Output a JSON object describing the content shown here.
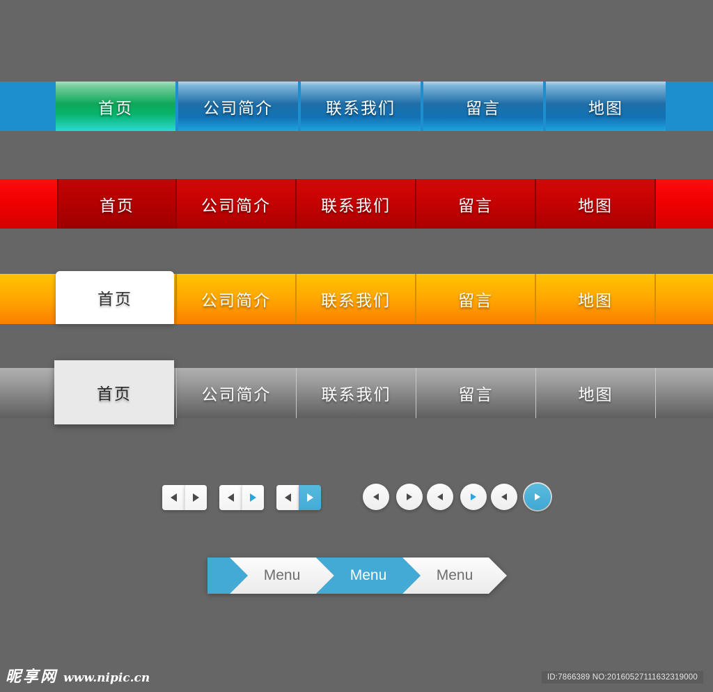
{
  "page": {
    "background": "#666666",
    "accent_blue": "#42aad4"
  },
  "navbars": [
    {
      "id": "blue",
      "style": "blue-gradient",
      "bar_color": "#1d8fce",
      "active_color": "#0fa85a",
      "items": [
        {
          "label": "首页",
          "active": true
        },
        {
          "label": "公司简介",
          "active": false
        },
        {
          "label": "联系我们",
          "active": false
        },
        {
          "label": "留言",
          "active": false
        },
        {
          "label": "地图",
          "active": false
        }
      ]
    },
    {
      "id": "red",
      "style": "red-gradient",
      "bar_color": "#f20000",
      "active_color": "#b40000",
      "items": [
        {
          "label": "首页",
          "active": true
        },
        {
          "label": "公司简介",
          "active": false
        },
        {
          "label": "联系我们",
          "active": false
        },
        {
          "label": "留言",
          "active": false
        },
        {
          "label": "地图",
          "active": false
        }
      ]
    },
    {
      "id": "orange",
      "style": "orange-gradient",
      "bar_color": "#ffa800",
      "active_color": "#ffffff",
      "items": [
        {
          "label": "首页",
          "active": true
        },
        {
          "label": "公司简介",
          "active": false
        },
        {
          "label": "联系我们",
          "active": false
        },
        {
          "label": "留言",
          "active": false
        },
        {
          "label": "地图",
          "active": false
        }
      ]
    },
    {
      "id": "gray",
      "style": "gray-gradient",
      "bar_color": "#8e8e8e",
      "active_color": "#e9e9e9",
      "items": [
        {
          "label": "首页",
          "active": true
        },
        {
          "label": "公司简介",
          "active": false
        },
        {
          "label": "联系我们",
          "active": false
        },
        {
          "label": "留言",
          "active": false
        },
        {
          "label": "地图",
          "active": false
        }
      ]
    }
  ],
  "pagers": {
    "square_groups": [
      {
        "prev_icon": "arrow-left-icon",
        "next_icon": "arrow-right-icon",
        "prev_state": "default",
        "next_state": "default"
      },
      {
        "prev_icon": "arrow-left-icon",
        "next_icon": "arrow-right-icon",
        "prev_state": "default",
        "next_state": "accent"
      },
      {
        "prev_icon": "arrow-left-icon",
        "next_icon": "arrow-right-icon",
        "prev_state": "default",
        "next_state": "filled"
      }
    ],
    "round_groups": [
      {
        "prev_icon": "arrow-left-icon",
        "next_icon": "arrow-right-icon",
        "prev_state": "default",
        "next_state": "default"
      },
      {
        "prev_icon": "arrow-left-icon",
        "next_icon": "arrow-right-icon",
        "prev_state": "default",
        "next_state": "accent"
      },
      {
        "prev_icon": "arrow-left-icon",
        "next_icon": "arrow-right-icon",
        "prev_state": "default",
        "next_state": "filled"
      }
    ]
  },
  "breadcrumb": {
    "start_color": "#42aad4",
    "items": [
      {
        "label": "Menu",
        "active": false
      },
      {
        "label": "Menu",
        "active": true
      },
      {
        "label": "Menu",
        "active": false
      }
    ]
  },
  "footer": {
    "brand_cn": "昵享网",
    "brand_url": "www.nipic.cn",
    "id_text": "ID:7866389 NO:20160527111632319000"
  }
}
